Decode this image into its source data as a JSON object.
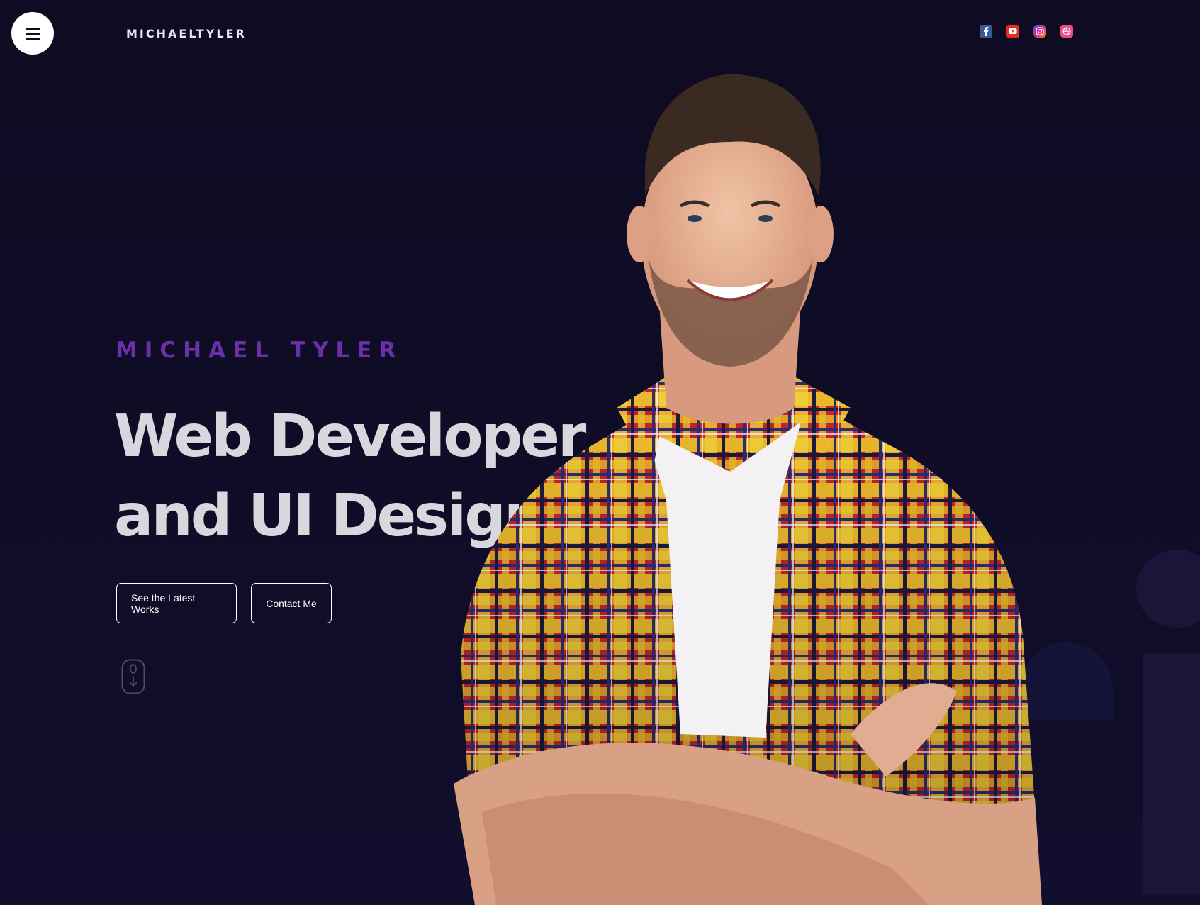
{
  "header": {
    "menu_icon": "hamburger-menu-icon",
    "logo": "MICHAELTYLER",
    "social": [
      {
        "name": "facebook",
        "icon": "facebook-icon",
        "color": "#3b5998"
      },
      {
        "name": "youtube",
        "icon": "youtube-icon",
        "color": "#e52d27"
      },
      {
        "name": "instagram",
        "icon": "instagram-icon",
        "color": "#d42a87"
      },
      {
        "name": "dribbble",
        "icon": "dribbble-icon",
        "color": "#ea4c89"
      }
    ]
  },
  "hero": {
    "eyebrow": "MICHAEL TYLER",
    "headline_line1": "Web Developer",
    "headline_line2": "and UI Design",
    "buttons": {
      "works": "See the Latest Works",
      "contact": "Contact Me"
    },
    "scroll_icon": "mouse-scroll-icon"
  },
  "colors": {
    "background": "#0f0c24",
    "accent": "#6b2fa8",
    "headline": "#d9d7de",
    "ghost_letter": "#19163a"
  }
}
